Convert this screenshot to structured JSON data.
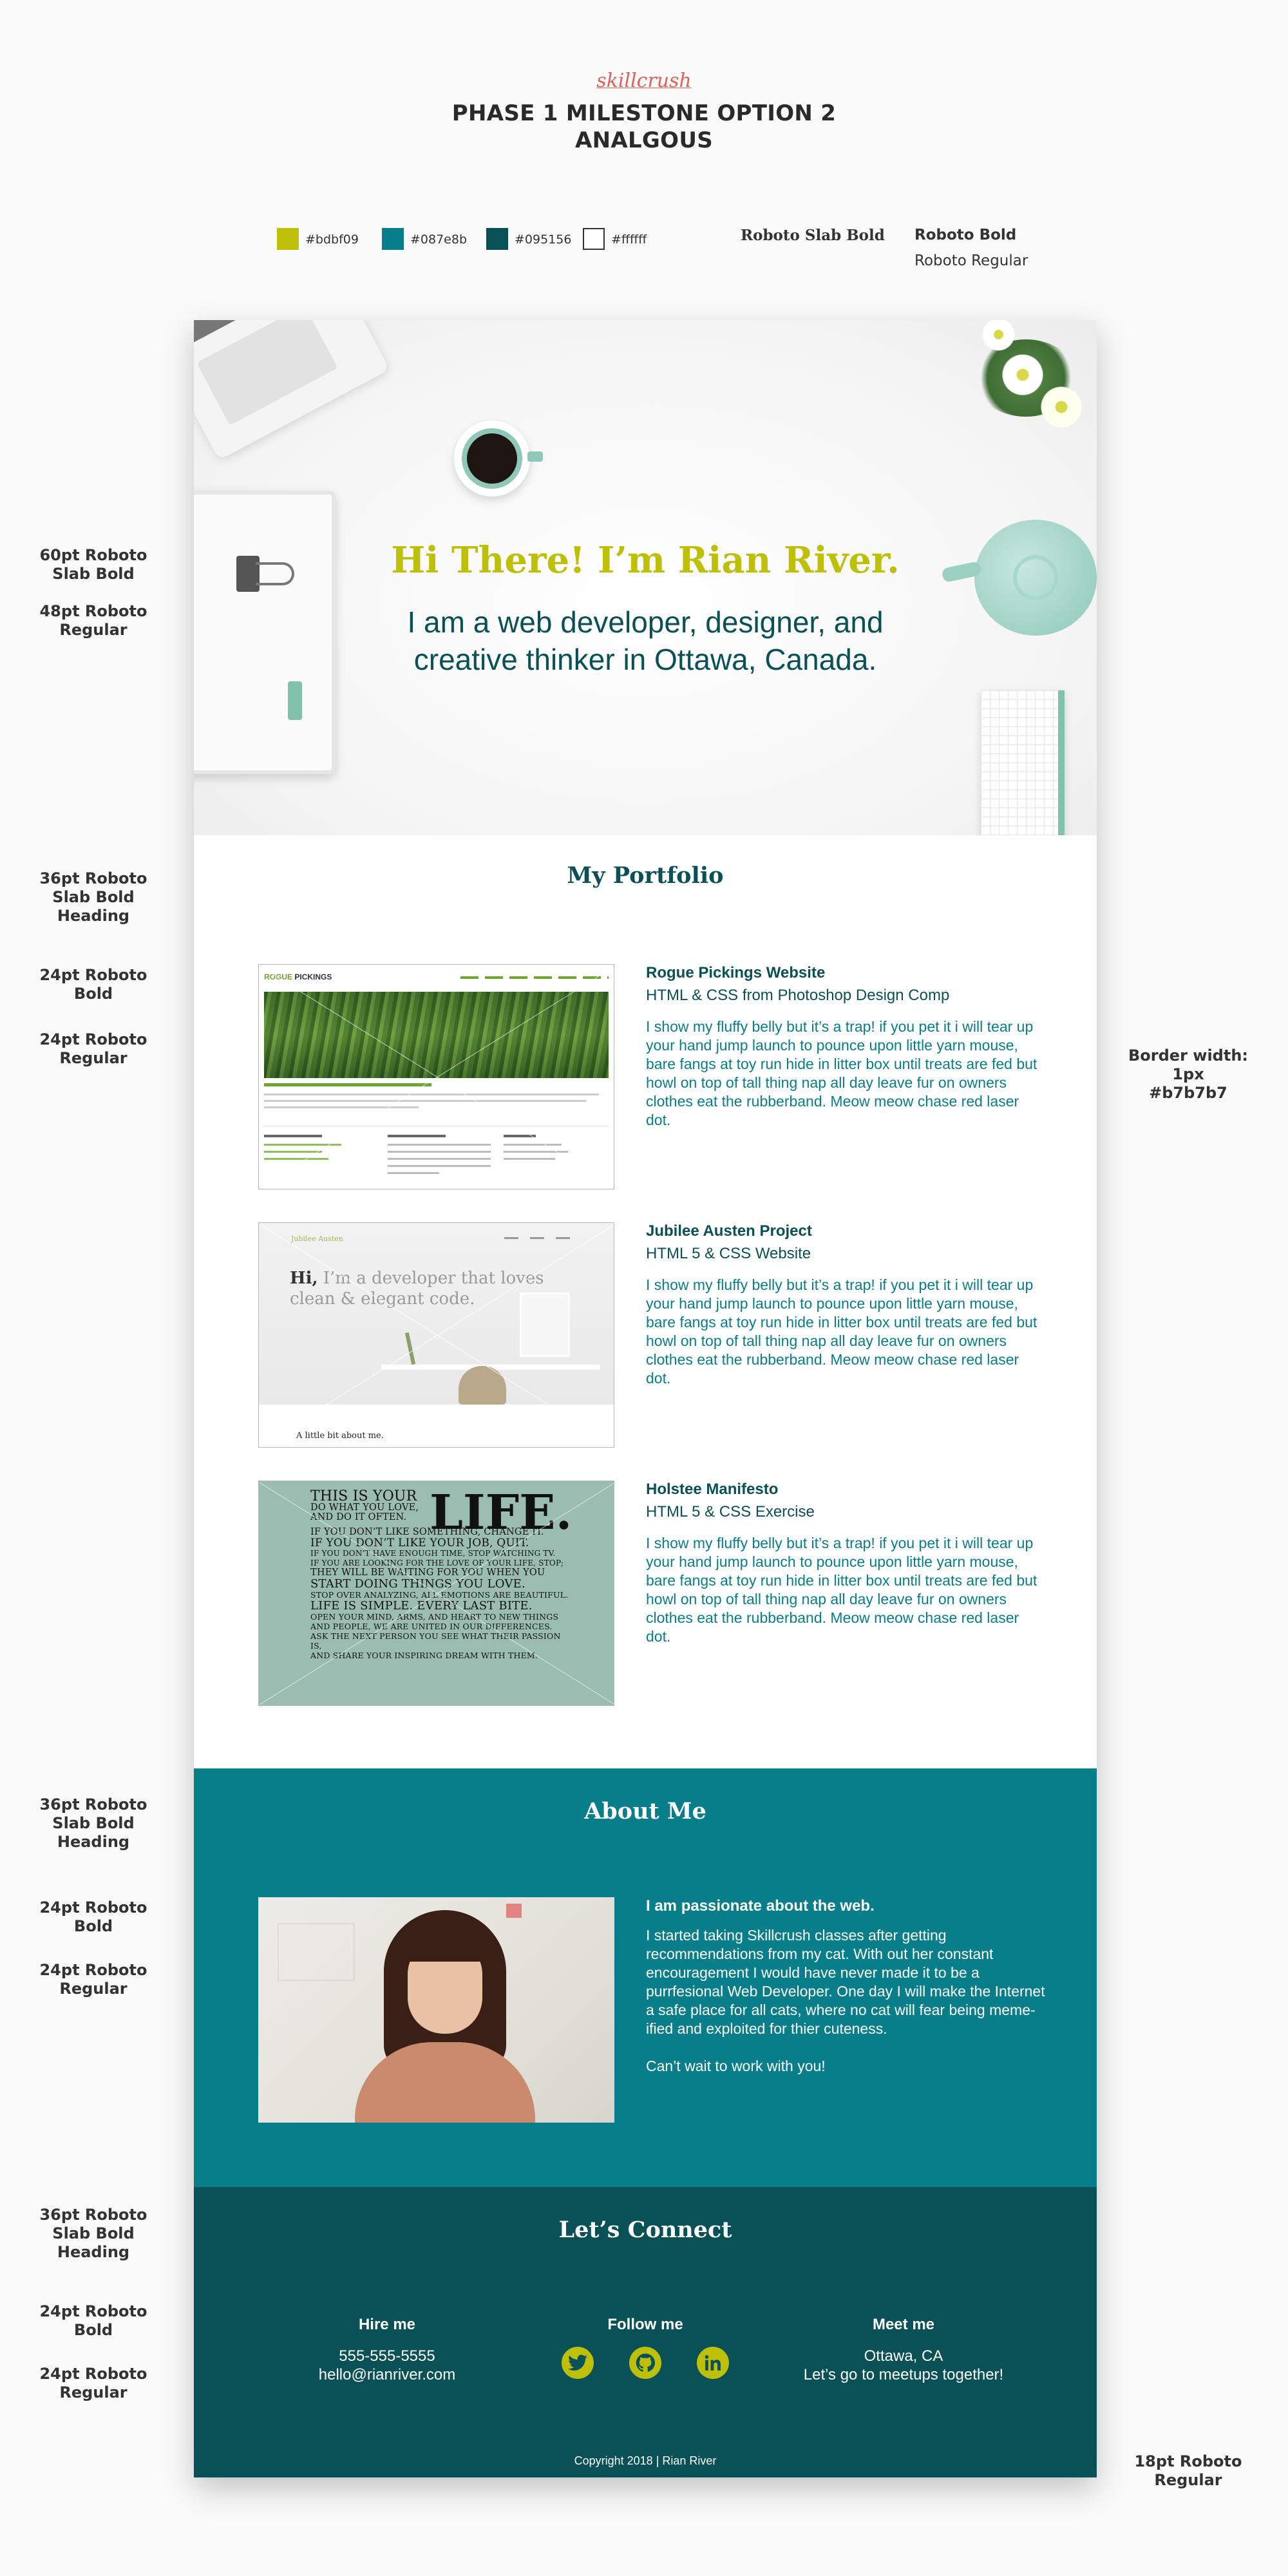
{
  "header": {
    "brand": "skillcrush",
    "title_line1": "PHASE 1 MILESTONE OPTION 2",
    "title_line2": "ANALGOUS"
  },
  "palette": [
    {
      "hex": "#bdbf09",
      "label": "#bdbf09"
    },
    {
      "hex": "#087e8b",
      "label": "#087e8b"
    },
    {
      "hex": "#095156",
      "label": "#095156"
    },
    {
      "hex": "#ffffff",
      "label": "#ffffff"
    }
  ],
  "fonts": {
    "slab_bold": "Roboto Slab Bold",
    "bold": "Roboto Bold",
    "regular": "Roboto Regular"
  },
  "annotations": {
    "hero_title": "60pt Roboto Slab Bold",
    "hero_sub": "48pt Roboto Regular",
    "portfolio_heading": "36pt Roboto Slab Bold Heading",
    "portfolio_bold": "24pt Roboto Bold",
    "portfolio_regular": "24pt Roboto Regular",
    "border_note_line1": "Border width: 1px",
    "border_note_line2": "#b7b7b7",
    "about_heading": "36pt Roboto Slab Bold Heading",
    "about_bold": "24pt Roboto Bold",
    "about_regular": "24pt Roboto Regular",
    "connect_heading": "36pt Roboto Slab Bold Heading",
    "connect_bold": "24pt Roboto Bold",
    "connect_regular": "24pt Roboto Regular",
    "footer_note": "18pt Roboto Regular"
  },
  "hero": {
    "title": "Hi There! I’m Rian River.",
    "subtitle_line1": "I am a web developer, designer, and",
    "subtitle_line2": "creative thinker in Ottawa, Canada."
  },
  "portfolio": {
    "heading": "My Portfolio",
    "projects": [
      {
        "title": "Rogue Pickings Website",
        "subtitle": "HTML & CSS from Photoshop Design Comp",
        "description": "I show my fluffy belly but it’s a trap! if you pet it i will tear up your hand jump launch to pounce upon little yarn mouse, bare fangs at toy run hide in litter box until treats are fed but howl on top of tall thing nap all day leave fur on owners clothes eat the rubberband. Meow meow chase red laser dot."
      },
      {
        "title": "Jubilee Austen Project",
        "subtitle": "HTML 5 & CSS Website",
        "description": "I show my fluffy belly but it’s a trap! if you pet it i will tear up your hand jump launch to pounce upon little yarn mouse, bare fangs at toy run hide in litter box until treats are fed but howl on top of tall thing nap all day leave fur on owners clothes eat the rubberband. Meow meow chase red laser dot."
      },
      {
        "title": "Holstee Manifesto",
        "subtitle": "HTML 5 & CSS Exercise",
        "description": "I show my fluffy belly but it’s a trap! if you pet it i will tear up your hand jump launch to pounce upon little yarn mouse, bare fangs at toy run hide in litter box until treats are fed but howl on top of tall thing nap all day leave fur on owners clothes eat the rubberband. Meow meow chase red laser dot."
      }
    ],
    "thumb1": {
      "logo_a": "ROGUE",
      "logo_b": " PICKINGS"
    },
    "thumb2": {
      "brand": "Jubilee Austen",
      "hi": "Hi,",
      "tagline": " I’m a developer that loves clean & elegant code.",
      "about": "A little bit about me."
    },
    "thumb3": {
      "lines": [
        "THIS IS YOUR",
        "DO WHAT YOU LOVE,",
        "AND DO IT OFTEN.",
        "IF YOU DON’T LIKE SOMETHING, CHANGE IT.",
        "IF YOU DON’T LIKE YOUR JOB, QUIT.",
        "IF YOU DON’T HAVE ENOUGH TIME, STOP WATCHING TV.",
        "IF YOU ARE LOOKING FOR THE LOVE OF YOUR LIFE, STOP;",
        "THEY WILL BE WAITING FOR YOU WHEN YOU",
        "START DOING THINGS YOU LOVE.",
        "STOP OVER ANALYZING, ALL EMOTIONS ARE BEAUTIFUL.",
        "LIFE IS SIMPLE. EVERY LAST BITE.",
        "OPEN YOUR MIND, ARMS, AND HEART TO NEW THINGS",
        "AND PEOPLE, WE ARE UNITED IN OUR DIFFERENCES.",
        "ASK THE NEXT PERSON YOU SEE WHAT THEIR PASSION IS,",
        "AND SHARE YOUR INSPIRING DREAM WITH THEM."
      ],
      "life": "LIFE."
    }
  },
  "about": {
    "heading": "About Me",
    "subheading": "I am passionate about the web.",
    "paragraph": "I started taking Skillcrush classes after getting recommendations from my cat. With out her constant encouragement I would have never made it to be a purrfesional Web Developer. One day I will make the Internet a safe place for all cats, where no cat will fear being meme-ified and exploited for thier cuteness.",
    "closing": "Can’t wait to work with you!"
  },
  "connect": {
    "heading": "Let’s Connect",
    "hire": {
      "label": "Hire me",
      "phone": "555-555-5555",
      "email": "hello@rianriver.com"
    },
    "follow": {
      "label": "Follow me",
      "icons": [
        "twitter-icon",
        "github-icon",
        "linkedin-icon"
      ]
    },
    "meet": {
      "label": "Meet me",
      "city": "Ottawa, CA",
      "note": "Let’s go to meetups together!"
    }
  },
  "footer": {
    "copyright": "Copyright 2018  |  Rian River"
  }
}
